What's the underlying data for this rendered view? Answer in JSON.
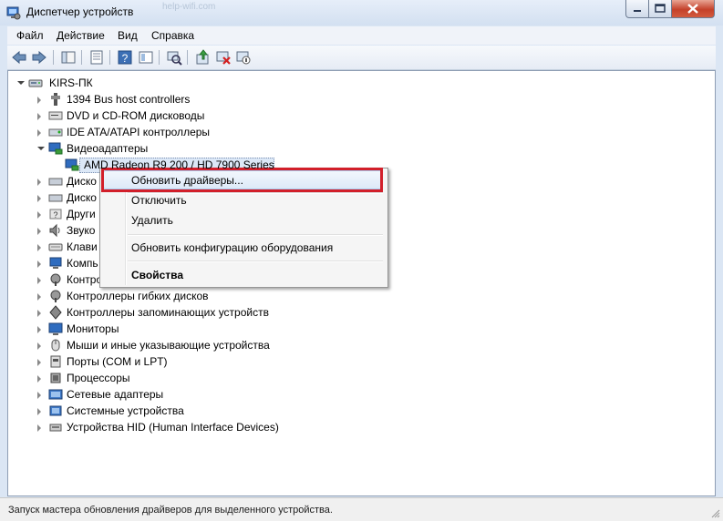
{
  "window": {
    "title": "Диспетчер устройств",
    "ghost_url": "help-wifi.com"
  },
  "menubar": {
    "items": [
      "Файл",
      "Действие",
      "Вид",
      "Справка"
    ]
  },
  "toolbar": {
    "buttons": [
      "back-icon",
      "forward-icon",
      "console-tree-icon",
      "properties-icon",
      "help-icon",
      "scan-hardware-icon",
      "update-driver-icon",
      "uninstall-icon",
      "disable-icon"
    ]
  },
  "tree": {
    "root": "KIRS-ПК",
    "categories": [
      {
        "label": "1394 Bus host controllers",
        "icon": "bus-icon"
      },
      {
        "label": "DVD и CD-ROM дисководы",
        "icon": "dvd-icon"
      },
      {
        "label": "IDE ATA/ATAPI контроллеры",
        "icon": "ide-icon"
      },
      {
        "label": "Видеоадаптеры",
        "icon": "display-adapter-icon",
        "expanded": true,
        "children": [
          "AMD Radeon R9 200 / HD 7900 Series"
        ]
      },
      {
        "label": "Диско",
        "icon": "disk-icon"
      },
      {
        "label": "Диско",
        "icon": "disk-icon"
      },
      {
        "label": "Други",
        "icon": "other-devices-icon"
      },
      {
        "label": "Звуко",
        "icon": "sound-icon"
      },
      {
        "label": "Клави",
        "icon": "keyboard-icon"
      },
      {
        "label": "Компь",
        "icon": "computer-icon"
      },
      {
        "label": "Контро",
        "icon": "controller-icon"
      },
      {
        "label": "Контроллеры гибких дисков",
        "icon": "floppy-controller-icon"
      },
      {
        "label": "Контроллеры запоминающих устройств",
        "icon": "storage-controller-icon"
      },
      {
        "label": "Мониторы",
        "icon": "monitor-icon"
      },
      {
        "label": "Мыши и иные указывающие устройства",
        "icon": "mouse-icon"
      },
      {
        "label": "Порты (COM и LPT)",
        "icon": "port-icon"
      },
      {
        "label": "Процессоры",
        "icon": "processor-icon"
      },
      {
        "label": "Сетевые адаптеры",
        "icon": "network-adapter-icon"
      },
      {
        "label": "Системные устройства",
        "icon": "system-device-icon"
      },
      {
        "label": "Устройства HID (Human Interface Devices)",
        "icon": "hid-icon"
      }
    ]
  },
  "context_menu": {
    "items": [
      {
        "label": "Обновить драйверы...",
        "highlighted": true
      },
      {
        "label": "Отключить"
      },
      {
        "label": "Удалить"
      },
      {
        "label": "Обновить конфигурацию оборудования"
      },
      {
        "label": "Свойства",
        "bold": true
      }
    ]
  },
  "statusbar": {
    "text": "Запуск мастера обновления драйверов для выделенного устройства."
  },
  "colors": {
    "highlight_frame": "#d21f2a",
    "window_frame": "#dbe6f4"
  }
}
